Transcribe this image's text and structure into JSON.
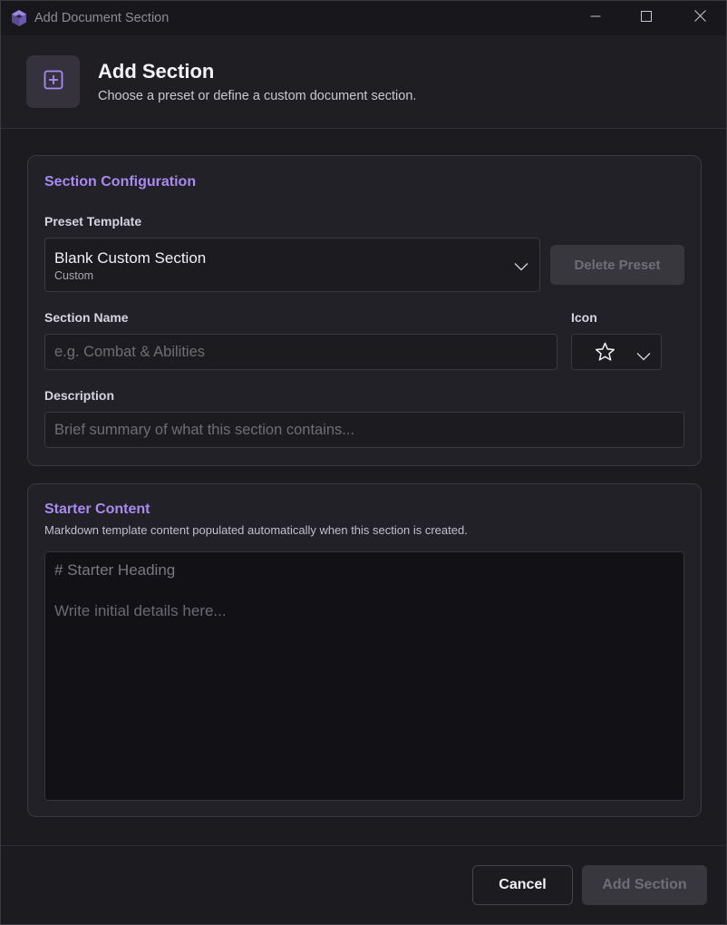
{
  "window": {
    "title": "Add Document Section",
    "app_icon": "cube-icon",
    "controls": [
      "minimize-icon",
      "maximize-icon",
      "close-icon"
    ]
  },
  "header": {
    "icon": "plus-square-icon",
    "title": "Add Section",
    "subtitle": "Choose a preset or define a custom document section."
  },
  "config": {
    "title": "Section Configuration",
    "preset_label": "Preset Template",
    "preset_value": "Blank Custom Section",
    "preset_type": "Custom",
    "delete_label": "Delete Preset",
    "name_label": "Section Name",
    "name_placeholder": "e.g. Combat & Abilities",
    "icon_label": "Icon",
    "icon_value": "star-icon",
    "description_label": "Description",
    "description_placeholder": "Brief summary of what this section contains..."
  },
  "starter": {
    "title": "Starter Content",
    "subtitle": "Markdown template content populated automatically when this section is created.",
    "placeholder_line1": "# Starter Heading",
    "placeholder_line2": "Write initial details here..."
  },
  "footer": {
    "cancel_label": "Cancel",
    "add_label": "Add Section"
  },
  "colors": {
    "accent": "#a98af0",
    "background": "#1c1b20",
    "card": "#222127",
    "disabled_button": "#38373e"
  }
}
